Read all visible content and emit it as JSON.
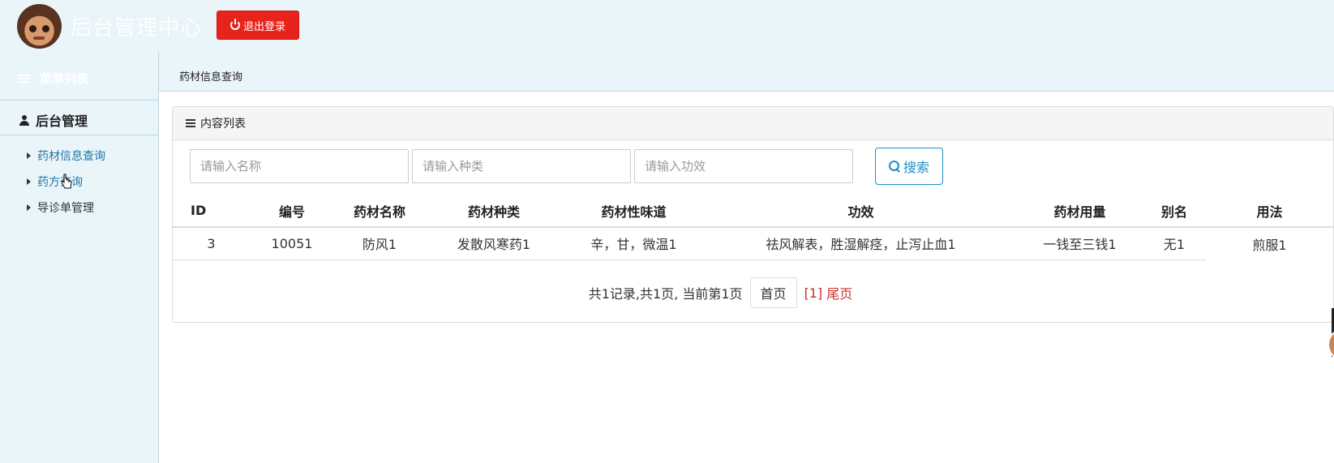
{
  "header": {
    "title": "后台管理中心",
    "logout_label": "退出登录"
  },
  "sidebar": {
    "menu_title": "菜单列表",
    "group_title": "后台管理",
    "items": [
      {
        "label": "药材信息查询"
      },
      {
        "label": "药方查询"
      },
      {
        "label": "导诊单管理"
      }
    ]
  },
  "breadcrumb": {
    "current_tab": "药材信息查询"
  },
  "panel": {
    "title": "内容列表"
  },
  "search": {
    "name_placeholder": "请输入名称",
    "category_placeholder": "请输入种类",
    "effect_placeholder": "请输入功效",
    "button_label": "搜索"
  },
  "table": {
    "headers": [
      "ID",
      "编号",
      "药材名称",
      "药材种类",
      "药材性味道",
      "功效",
      "药材用量",
      "别名",
      "用法"
    ],
    "rows": [
      [
        "3",
        "10051",
        "防风1",
        "发散风寒药1",
        "辛，甘，微温1",
        "祛风解表，胜湿解痉，止泻止血1",
        "一钱至三钱1",
        "无1",
        "煎服1"
      ]
    ]
  },
  "pager": {
    "summary": "共1记录,共1页, 当前第1页",
    "first_label": "首页",
    "current_page": "[1]",
    "last_label": "尾页"
  },
  "colors": {
    "background": "#eaf5fa",
    "logout_red": "#e8231b",
    "link_blue": "#1f75a6",
    "search_blue": "#1f8fc4",
    "pager_red": "#c9302c"
  }
}
